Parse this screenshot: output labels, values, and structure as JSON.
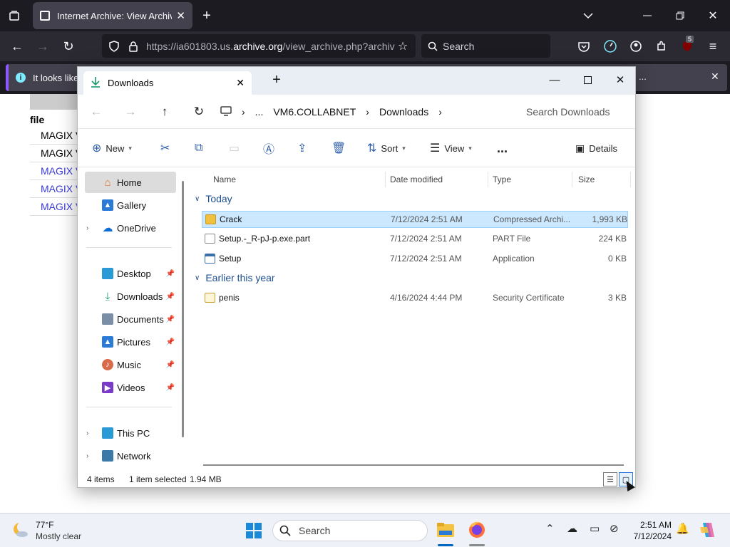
{
  "browser": {
    "tab_title": "Internet Archive: View Archive",
    "url_prefix": "https://ia601803.us.",
    "url_domain": "archive.org",
    "url_suffix": "/view_archive.php?archiv",
    "search_placeholder": "Search",
    "notification_text": "It looks like",
    "notification_more": "...",
    "badge_count": "5"
  },
  "page": {
    "header": "file",
    "rows": [
      "MAGIX V",
      "MAGIX V",
      "MAGIX V",
      "MAGIX V",
      "MAGIX V"
    ]
  },
  "explorer": {
    "tab_title": "Downloads",
    "breadcrumb": {
      "overflow": "...",
      "root": "VM6.COLLABNET",
      "current": "Downloads"
    },
    "search_placeholder": "Search Downloads",
    "commands": {
      "new": "New",
      "sort": "Sort",
      "view": "View",
      "more": "...",
      "details": "Details"
    },
    "nav": {
      "home": "Home",
      "gallery": "Gallery",
      "onedrive": "OneDrive",
      "desktop": "Desktop",
      "downloads": "Downloads",
      "documents": "Documents",
      "pictures": "Pictures",
      "music": "Music",
      "videos": "Videos",
      "this_pc": "This PC",
      "network": "Network"
    },
    "columns": {
      "name": "Name",
      "date": "Date modified",
      "type": "Type",
      "size": "Size"
    },
    "groups": {
      "today": "Today",
      "earlier": "Earlier this year"
    },
    "files": [
      {
        "name": "Crack",
        "date": "7/12/2024 2:51 AM",
        "type": "Compressed Archi...",
        "size": "1,993 KB"
      },
      {
        "name": "Setup.-_R-pJ-p.exe.part",
        "date": "7/12/2024 2:51 AM",
        "type": "PART File",
        "size": "224 KB"
      },
      {
        "name": "Setup",
        "date": "7/12/2024 2:51 AM",
        "type": "Application",
        "size": "0 KB"
      },
      {
        "name": "penis",
        "date": "4/16/2024 4:44 PM",
        "type": "Security Certificate",
        "size": "3 KB"
      }
    ],
    "status": {
      "items": "4 items",
      "selected": "1 item selected",
      "size": "1.94 MB"
    }
  },
  "taskbar": {
    "temperature": "77°F",
    "weather": "Mostly clear",
    "search_placeholder": "Search",
    "time": "2:51 AM",
    "date": "7/12/2024"
  },
  "colors": {
    "firefox_bg": "#1c1b22",
    "selection": "#cce8ff",
    "accent": "#0067c0"
  }
}
